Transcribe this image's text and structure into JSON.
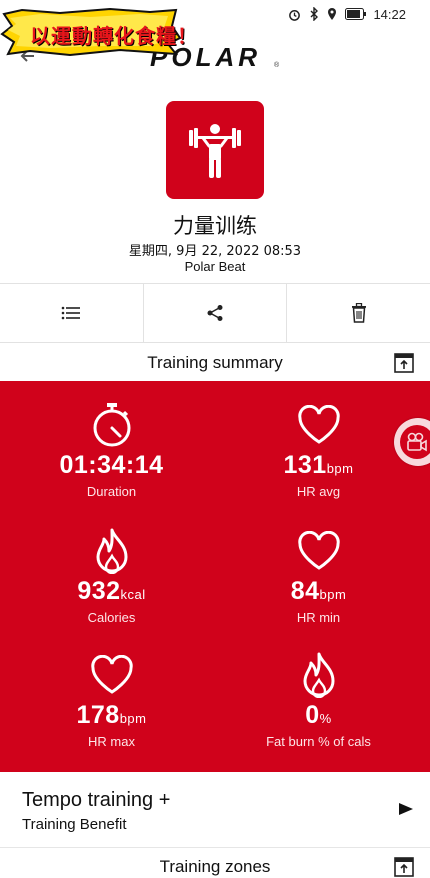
{
  "status_bar": {
    "time": "14:22"
  },
  "overlay": {
    "sticker_text": "以運動轉化食糧！"
  },
  "header": {
    "logo_text": "POLAR",
    "logo_mark": "®"
  },
  "session": {
    "sport_name": "力量训练",
    "date_time": "星期四, 9月 22, 2022 08:53",
    "device": "Polar Beat",
    "icon": "weightlifting-icon"
  },
  "actions": [
    {
      "name": "list-icon"
    },
    {
      "name": "share-icon"
    },
    {
      "name": "delete-icon"
    }
  ],
  "summary": {
    "title": "Training summary",
    "stats": [
      {
        "icon": "stopwatch-icon",
        "value": "01:34:14",
        "unit": "",
        "label": "Duration"
      },
      {
        "icon": "heart-icon",
        "value": "131",
        "unit": "bpm",
        "label": "HR avg"
      },
      {
        "icon": "flame-icon",
        "value": "932",
        "unit": "kcal",
        "label": "Calories"
      },
      {
        "icon": "heart-icon",
        "value": "84",
        "unit": "bpm",
        "label": "HR min"
      },
      {
        "icon": "heart-icon",
        "value": "178",
        "unit": "bpm",
        "label": "HR max"
      },
      {
        "icon": "flame-icon",
        "value": "0",
        "unit": "%",
        "label": "Fat burn % of cals"
      }
    ]
  },
  "benefit": {
    "title": "Tempo training +",
    "subtitle": "Training Benefit"
  },
  "zones": {
    "title": "Training zones"
  },
  "colors": {
    "accent": "#d0021b",
    "text": "#111111",
    "divider": "#e2e2e2"
  }
}
